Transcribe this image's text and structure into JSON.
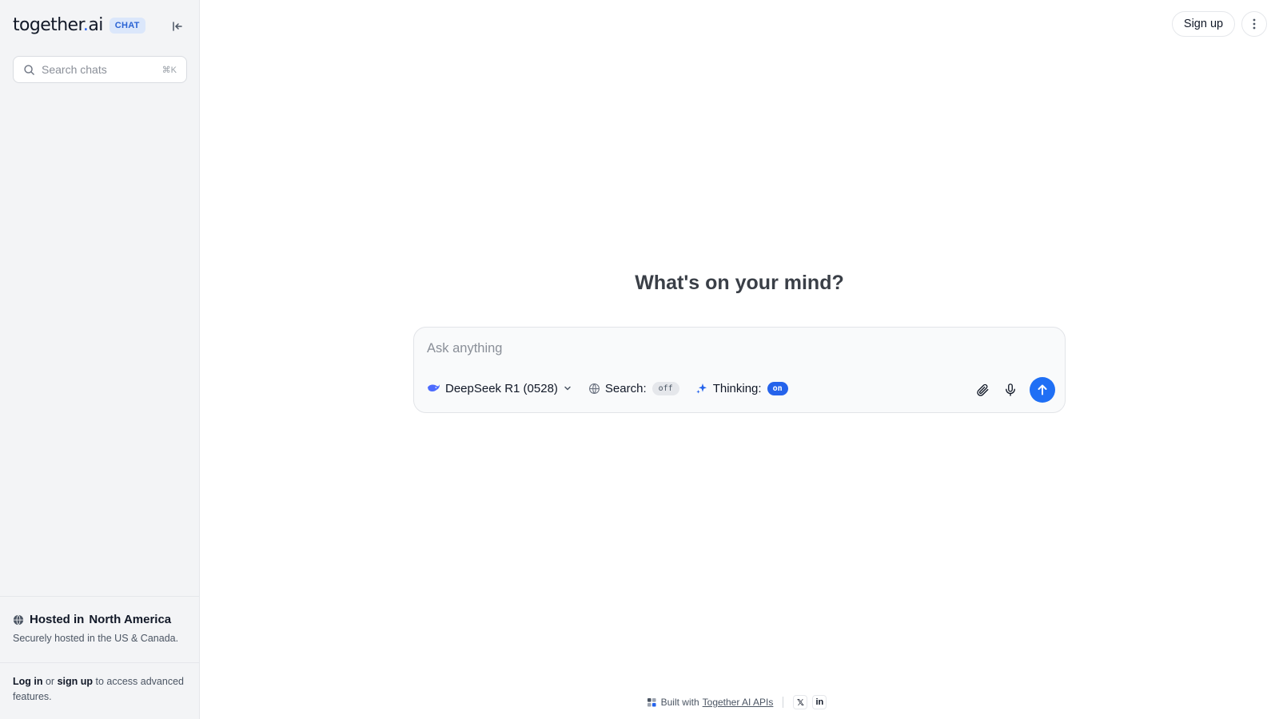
{
  "sidebar": {
    "logo_left": "together",
    "logo_dot": ".",
    "logo_right": "ai",
    "badge": "CHAT",
    "search": {
      "placeholder": "Search chats",
      "shortcut": "⌘K"
    },
    "hosted": {
      "label": "Hosted in",
      "region": "North America",
      "subtitle": "Securely hosted in the US & Canada."
    },
    "login_note": {
      "login": "Log in",
      "or": " or ",
      "signup": "sign up",
      "rest": " to access advanced features."
    }
  },
  "header": {
    "signup": "Sign up"
  },
  "main": {
    "headline": "What's on your mind?",
    "composer": {
      "placeholder": "Ask anything",
      "model": "DeepSeek R1 (0528)",
      "search_label": "Search:",
      "search_state": "off",
      "thinking_label": "Thinking:",
      "thinking_state": "on"
    }
  },
  "footer": {
    "built_with": "Built with",
    "link": "Together AI APIs",
    "x": "𝕏",
    "linkedin": "in"
  },
  "colors": {
    "accent": "#1f6ff5",
    "badge_bg": "#dbe7fb",
    "sidebar_bg": "#f3f4f6"
  }
}
